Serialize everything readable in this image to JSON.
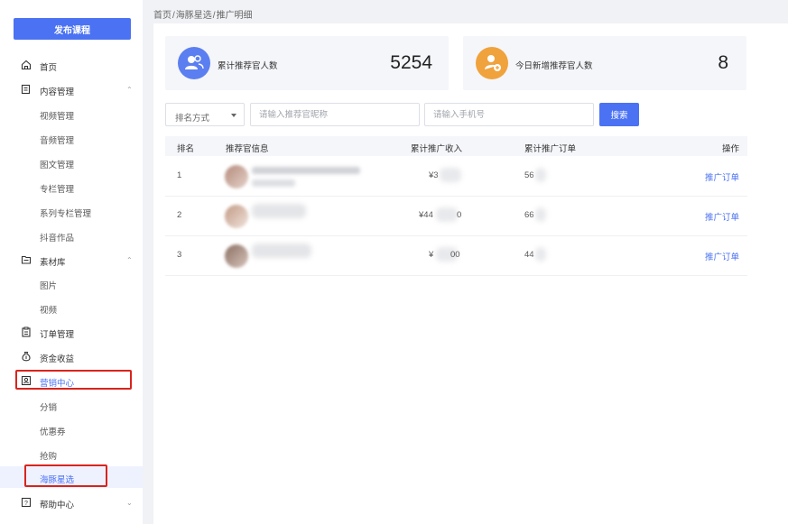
{
  "sidebar": {
    "publish_button": "发布课程",
    "items": {
      "home": "首页",
      "content": "内容管理",
      "video": "视频管理",
      "audio": "音频管理",
      "article": "图文管理",
      "column": "专栏管理",
      "series": "系列专栏管理",
      "douyin": "抖音作品",
      "material": "素材库",
      "image": "图片",
      "material_video": "视频",
      "orders": "订单管理",
      "funds": "资金收益",
      "marketing": "营销中心",
      "distribution": "分销",
      "coupon": "优惠券",
      "flash_sale": "抢购",
      "dolphin": "海豚星选",
      "help": "帮助中心"
    }
  },
  "breadcrumb": {
    "home": "首页",
    "sep": "/",
    "section": "海豚星选",
    "current": "推广明细"
  },
  "stats": {
    "total_label": "累计推荐官人数",
    "total_value": "5254",
    "today_label": "今日新增推荐官人数",
    "today_value": "8"
  },
  "filters": {
    "sort_value": "排名方式",
    "nickname_placeholder": "请输入推荐官昵称",
    "phone_placeholder": "请输入手机号",
    "search_label": "搜索"
  },
  "table": {
    "headers": {
      "rank": "排名",
      "info": "推荐官信息",
      "income": "累计推广收入",
      "orders": "累计推广订单",
      "action": "操作"
    },
    "rows": [
      {
        "rank": "1",
        "income": "¥3",
        "orders": "56",
        "action": "推广订单"
      },
      {
        "rank": "2",
        "income": "¥44",
        "income_tail": "0",
        "orders": "66",
        "action": "推广订单"
      },
      {
        "rank": "3",
        "income": "¥",
        "income_tail": "00",
        "orders": "44",
        "action": "推广订单"
      }
    ]
  },
  "colors": {
    "accent": "#4b72f2",
    "highlight_box": "#d9241c",
    "stat_icon_blue": "#5b7ff0",
    "stat_icon_orange": "#f0a23c"
  }
}
